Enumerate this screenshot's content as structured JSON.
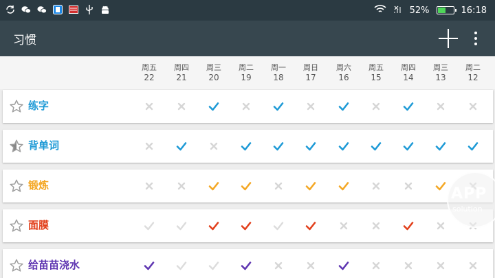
{
  "status_bar": {
    "notification_icons": [
      "sync-icon",
      "wechat-icon",
      "wechat-icon",
      "app-icon",
      "mail-icon",
      "usb-icon",
      "android-icon"
    ],
    "battery_percent": "52%",
    "battery_level": 0.52,
    "time": "16:18"
  },
  "app_bar": {
    "title": "习惯"
  },
  "days": [
    {
      "dow": "周五",
      "date": "22"
    },
    {
      "dow": "周四",
      "date": "21"
    },
    {
      "dow": "周三",
      "date": "20"
    },
    {
      "dow": "周二",
      "date": "19"
    },
    {
      "dow": "周一",
      "date": "18"
    },
    {
      "dow": "周日",
      "date": "17"
    },
    {
      "dow": "周六",
      "date": "16"
    },
    {
      "dow": "周五",
      "date": "15"
    },
    {
      "dow": "周四",
      "date": "14"
    },
    {
      "dow": "周三",
      "date": "13"
    },
    {
      "dow": "周二",
      "date": "12"
    }
  ],
  "habits": [
    {
      "name": "练字",
      "color": "#1e9ad6",
      "star": "empty",
      "checks": [
        0,
        0,
        1,
        0,
        1,
        0,
        1,
        0,
        1,
        0,
        0
      ]
    },
    {
      "name": "背单词",
      "color": "#1e9ad6",
      "star": "half",
      "checks": [
        0,
        1,
        0,
        1,
        1,
        1,
        1,
        1,
        1,
        1,
        1
      ]
    },
    {
      "name": "锻炼",
      "color": "#f4a724",
      "star": "empty",
      "checks": [
        0,
        0,
        1,
        1,
        0,
        1,
        1,
        0,
        0,
        1,
        0
      ]
    },
    {
      "name": "面膜",
      "color": "#e2401c",
      "star": "empty",
      "checks": [
        0.5,
        0.5,
        1,
        1,
        0.5,
        1,
        0,
        0,
        1,
        0,
        0
      ]
    },
    {
      "name": "给苗苗浇水",
      "color": "#5e35b1",
      "star": "empty",
      "checks": [
        1,
        0.5,
        0.5,
        1,
        0,
        0,
        1,
        0,
        0,
        0,
        0
      ]
    }
  ],
  "watermark": {
    "title": "APP",
    "subtitle": "solution"
  }
}
